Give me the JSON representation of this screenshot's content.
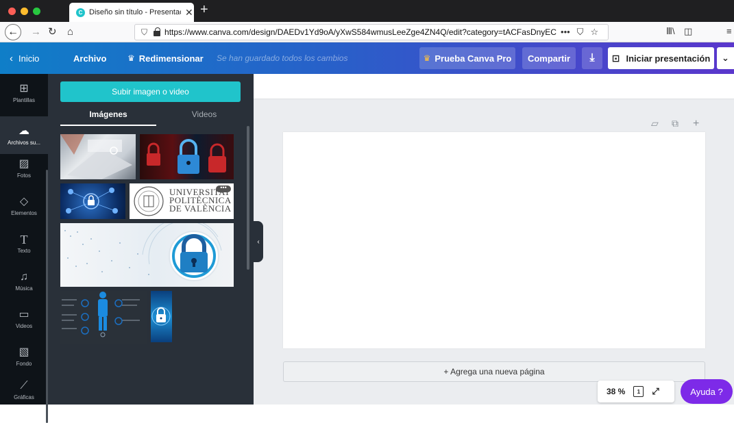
{
  "browser": {
    "tab_title": "Diseño sin título - Presentación",
    "tab_favicon": "C",
    "url": "https://www.canva.com/design/DAEDv1Yd9oA/yXwS584wmusLeeZge4ZN4Q/edit?category=tACFasDnyEC",
    "url_more": "•••"
  },
  "topbar": {
    "home_label": "Inicio",
    "file_label": "Archivo",
    "resize_label": "Redimensionar",
    "saved_status": "Se han guardado todos los cambios",
    "pro_label": "Prueba Canva Pro",
    "share_label": "Compartir",
    "present_label": "Iniciar presentación"
  },
  "rail": {
    "items": [
      {
        "label": "Plantillas",
        "icon": "template-icon"
      },
      {
        "label": "Archivos su...",
        "icon": "upload-cloud-icon"
      },
      {
        "label": "Fotos",
        "icon": "photo-icon"
      },
      {
        "label": "Elementos",
        "icon": "elements-icon"
      },
      {
        "label": "Texto",
        "icon": "text-icon"
      },
      {
        "label": "Música",
        "icon": "music-icon"
      },
      {
        "label": "Videos",
        "icon": "video-icon"
      },
      {
        "label": "Fondo",
        "icon": "background-icon"
      },
      {
        "label": "Gráficas",
        "icon": "chart-icon"
      }
    ]
  },
  "panel": {
    "upload_label": "Subir imagen o video",
    "tab_images": "Imágenes",
    "tab_videos": "Videos",
    "upv_logo": {
      "line1": "UNIVERSITAT",
      "line2": "POLITÈCNICA",
      "line3": "DE VALÈNCIA"
    },
    "more_dots": "•••"
  },
  "editor": {
    "add_page_label": "+ Agrega una nueva página",
    "zoom": "38 %",
    "page_count": "1",
    "help_label": "Ayuda ?"
  },
  "colors": {
    "canva_teal": "#20c4cb",
    "help_purple": "#7d2ae8",
    "panel_bg": "#293039"
  }
}
